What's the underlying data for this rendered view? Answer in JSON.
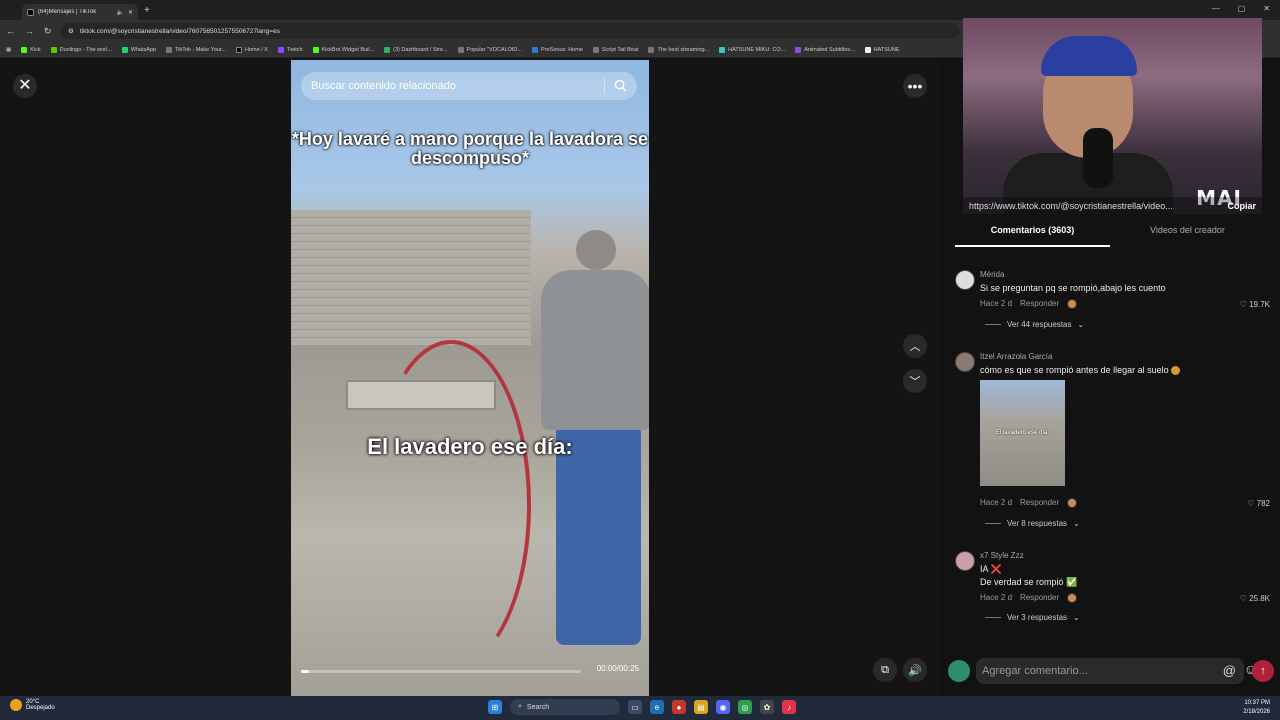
{
  "browser": {
    "tab_title": "(64)Mensajes | TikTok",
    "url": "tiktok.com/@soycristianestrella/video/7607565012575506727lang=es",
    "bookmarks": [
      "Kick",
      "Duolingo - The worl...",
      "WhatsApp",
      "TikTok - Make Your...",
      "Home / X",
      "Twitch",
      "KickBot Widget Buil...",
      "(3) Dashboard / Stre...",
      "Popular \"VOCALOID...",
      "PreSonus: Home",
      "Script Tail Beat",
      "The best streaming...",
      "HATSUNE MIKU: CO...",
      "Animated Subtitles...",
      "HATSUNE"
    ]
  },
  "player": {
    "search_placeholder": "Buscar contenido relacionado",
    "caption_top": "*Hoy lavaré a mano porque la lavadora se descompuso*",
    "caption_mid": "El lavadero ese día:",
    "timecode": "00:00/00:25",
    "progress": 0.03
  },
  "panel": {
    "overlay_url": "https://www.tiktok.com/@soycristianestrella/video...",
    "copy_label": "Copiar",
    "watermark": "MAI",
    "tab_comments": "Comentarios (3603)",
    "tab_creator": "Videos del creador",
    "comments": [
      {
        "user": "Mérida",
        "text": "Si se preguntan pq se rompió,abajo les cuento",
        "time": "Hace 2 d",
        "reply": "Responder",
        "likes": "19.7K",
        "replies": "Ver 44 respuestas"
      },
      {
        "user": "Itzel Arrazola García",
        "text": "cómo es que se rompió antes de llegar al suelo",
        "time": "Hace 2 d",
        "reply": "Responder",
        "likes": "782",
        "replies": "Ver 8 respuestas",
        "thumb_text": "El lavadero ese día:"
      },
      {
        "user": "x7 Style Zzz",
        "text": "IA ❌",
        "text2": "De verdad se rompió ✅",
        "time": "Hace 2 d",
        "reply": "Responder",
        "likes": "25.8K",
        "replies": "Ver 3 respuestas"
      }
    ],
    "composer_placeholder": "Agregar comentario..."
  },
  "taskbar": {
    "temp": "20°C",
    "weather": "Despejado",
    "search": "Search",
    "time": "10:37 PM",
    "date": "2/18/2026"
  },
  "colors": {
    "accent": "#fe2c55",
    "send": "#b0223a"
  }
}
